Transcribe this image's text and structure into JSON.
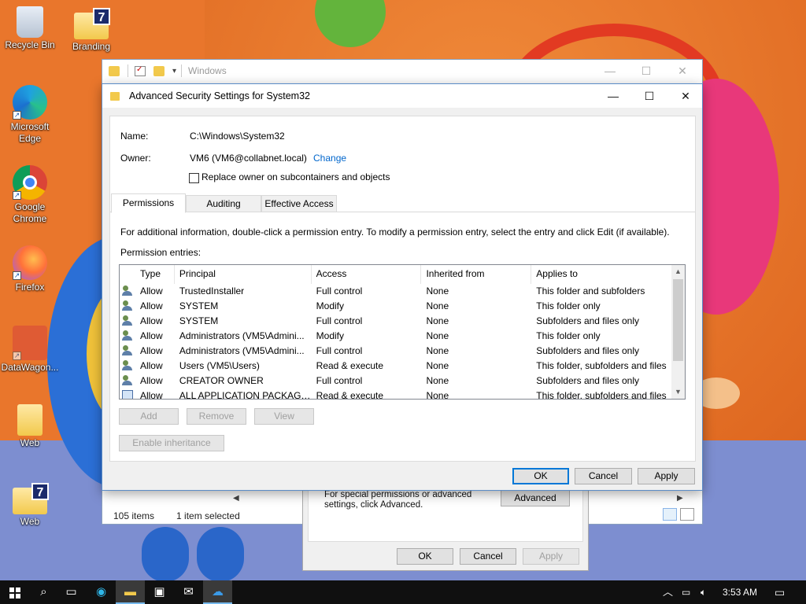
{
  "desktop": {
    "icons": [
      {
        "label": "Recycle Bin",
        "icon": "recycle-bin-icon"
      },
      {
        "label": "Branding",
        "icon": "folder-icon",
        "badge": "7"
      },
      {
        "label": "Microsoft Edge",
        "icon": "edge-icon"
      },
      {
        "label": "Google Chrome",
        "icon": "chrome-icon"
      },
      {
        "label": "Firefox",
        "icon": "firefox-icon"
      },
      {
        "label": "DataWagon...",
        "icon": "datawagon-icon"
      },
      {
        "label": "Web",
        "icon": "folder-icon"
      },
      {
        "label": "Web",
        "icon": "folder-icon",
        "badge": "7"
      }
    ]
  },
  "explorer": {
    "title": "Windows",
    "status_items": "105 items",
    "status_selected": "1 item selected"
  },
  "properties": {
    "text": "For special permissions or advanced settings, click Advanced.",
    "advanced_label": "Advanced",
    "ok_label": "OK",
    "cancel_label": "Cancel",
    "apply_label": "Apply"
  },
  "advanced": {
    "title": "Advanced Security Settings for System32",
    "name_label": "Name:",
    "name_value": "C:\\Windows\\System32",
    "owner_label": "Owner:",
    "owner_value": "VM6 (VM6@collabnet.local)",
    "change_label": "Change",
    "replace_owner_label": "Replace owner on subcontainers and objects",
    "tabs": [
      "Permissions",
      "Auditing",
      "Effective Access"
    ],
    "info_text": "For additional information, double-click a permission entry. To modify a permission entry, select the entry and click Edit (if available).",
    "entries_label": "Permission entries:",
    "columns": [
      "Type",
      "Principal",
      "Access",
      "Inherited from",
      "Applies to"
    ],
    "rows": [
      {
        "type": "Allow",
        "principal": "TrustedInstaller",
        "access": "Full control",
        "inherited": "None",
        "applies": "This folder and subfolders"
      },
      {
        "type": "Allow",
        "principal": "SYSTEM",
        "access": "Modify",
        "inherited": "None",
        "applies": "This folder only"
      },
      {
        "type": "Allow",
        "principal": "SYSTEM",
        "access": "Full control",
        "inherited": "None",
        "applies": "Subfolders and files only"
      },
      {
        "type": "Allow",
        "principal": "Administrators (VM5\\Admini...",
        "access": "Modify",
        "inherited": "None",
        "applies": "This folder only"
      },
      {
        "type": "Allow",
        "principal": "Administrators (VM5\\Admini...",
        "access": "Full control",
        "inherited": "None",
        "applies": "Subfolders and files only"
      },
      {
        "type": "Allow",
        "principal": "Users (VM5\\Users)",
        "access": "Read & execute",
        "inherited": "None",
        "applies": "This folder, subfolders and files"
      },
      {
        "type": "Allow",
        "principal": "CREATOR OWNER",
        "access": "Full control",
        "inherited": "None",
        "applies": "Subfolders and files only"
      },
      {
        "type": "Allow",
        "principal": "ALL APPLICATION PACKAGES",
        "access": "Read & execute",
        "inherited": "None",
        "applies": "This folder, subfolders and files"
      }
    ],
    "add_label": "Add",
    "remove_label": "Remove",
    "view_label": "View",
    "enable_inheritance_label": "Enable inheritance",
    "ok_label": "OK",
    "cancel_label": "Cancel",
    "apply_label": "Apply"
  },
  "taskbar": {
    "time": "3:53 AM",
    "items": [
      "start-icon",
      "search-icon",
      "task-view-icon",
      "edge-icon",
      "file-explorer-icon",
      "store-icon",
      "mail-icon",
      "onedrive-icon"
    ]
  },
  "colors": {
    "accent": "#0078d7",
    "link": "#0066cc",
    "taskbar": "#101010"
  }
}
